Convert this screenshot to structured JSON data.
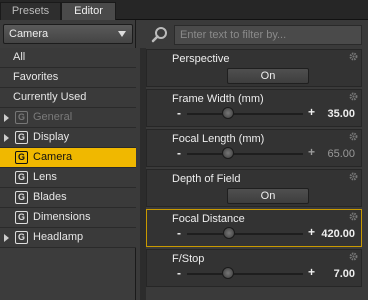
{
  "tabs": [
    {
      "label": "Presets"
    },
    {
      "label": "Editor"
    }
  ],
  "category_dropdown": {
    "selected": "Camera"
  },
  "nav": {
    "items": [
      {
        "label": "All"
      },
      {
        "label": "Favorites"
      },
      {
        "label": "Currently Used"
      },
      {
        "label": "General"
      },
      {
        "label": "Display"
      },
      {
        "label": "Camera"
      },
      {
        "label": "Lens"
      },
      {
        "label": "Blades"
      },
      {
        "label": "Dimensions"
      },
      {
        "label": "Headlamp"
      }
    ],
    "group_icon_glyph": "G"
  },
  "search": {
    "placeholder": "Enter text to filter by..."
  },
  "properties": [
    {
      "label": "Perspective",
      "button": "On"
    },
    {
      "label": "Frame Width (mm)",
      "minus": "-",
      "plus": "+",
      "value": "35.00",
      "slider_level": 0.35
    },
    {
      "label": "Focal Length (mm)",
      "minus": "-",
      "plus": "+",
      "value": "65.00",
      "slider_level": 0.35
    },
    {
      "label": "Depth of Field",
      "button": "On"
    },
    {
      "label": "Focal Distance",
      "minus": "-",
      "plus": "+",
      "value": "420.00",
      "slider_level": 0.36
    },
    {
      "label": "F/Stop",
      "minus": "-",
      "plus": "+",
      "value": "7.00",
      "slider_level": 0.35
    }
  ],
  "colors": {
    "selection": "#f0b800",
    "highlight_border": "#c99a00"
  },
  "icons": [
    "search-icon",
    "gear-icon",
    "expand-arrow-icon",
    "group-icon",
    "dropdown-arrow-icon"
  ]
}
